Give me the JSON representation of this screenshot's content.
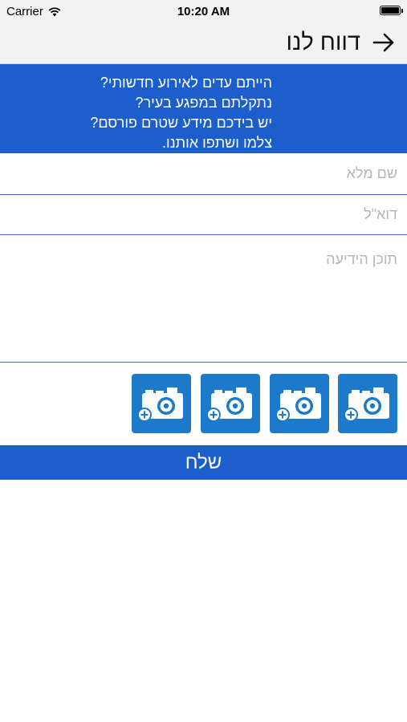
{
  "status_bar": {
    "carrier": "Carrier",
    "time": "10:20 AM",
    "wifi_icon": "wifi-icon",
    "battery_icon": "battery-icon"
  },
  "nav": {
    "title": "דווח לנו",
    "back_icon": "arrow-right-icon"
  },
  "intro": {
    "lines": [
      "הייתם עדים לאירוע חדשותי?",
      "נתקלתם במפגע בעיר?",
      "יש בידכם מידע שטרם פורסם?",
      "צלמו ושתפו אותנו."
    ]
  },
  "form": {
    "name_placeholder": "שם מלא",
    "email_placeholder": "דוא\"ל",
    "content_placeholder": "תוכן הידיעה",
    "name_value": "",
    "email_value": "",
    "content_value": ""
  },
  "photos": {
    "icon": "add-photo-camera-icon",
    "count": 4
  },
  "send_label": "שלח",
  "colors": {
    "primary_blue": "#1c5fcc",
    "photo_button_blue": "#1d79c9",
    "bar_gray": "#f2f2f2",
    "placeholder_gray": "#b5b5b5"
  }
}
